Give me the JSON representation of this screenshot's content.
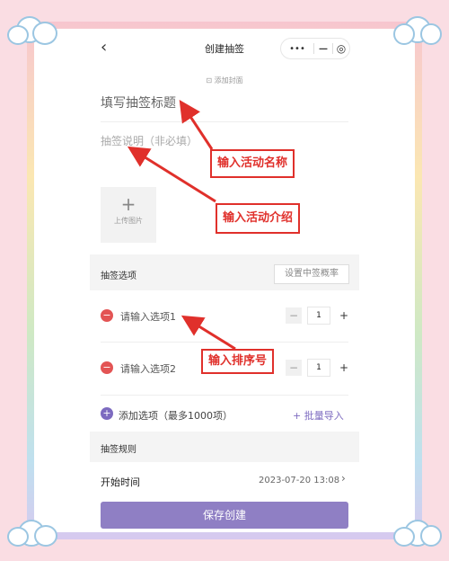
{
  "nav": {
    "back_icon": "‹",
    "title": "创建抽签",
    "capsule_more": "•••",
    "capsule_minimize": "—",
    "capsule_close": "◎"
  },
  "cover_link": "⊡ 添加封面",
  "form": {
    "title_placeholder": "填写抽签标题",
    "desc_placeholder": "抽签说明（非必填）",
    "upload_plus": "+",
    "upload_label": "上传图片"
  },
  "options_section": {
    "heading": "抽签选项",
    "probability_button": "设置中签概率",
    "options": [
      {
        "placeholder": "请输入选项1",
        "count": "1"
      },
      {
        "placeholder": "请输入选项2",
        "count": "1"
      }
    ],
    "stepper_minus": "−",
    "stepper_plus": "+",
    "add_option": "添加选项（最多1000项）",
    "batch_import": "+ 批量导入"
  },
  "rules_section": {
    "heading": "抽签规则",
    "start_time_label": "开始时间",
    "start_time_value": "2023-07-20 13:08",
    "chevron": "›"
  },
  "save_button": "保存创建",
  "annotations": {
    "activity_name": "输入活动名称",
    "activity_intro": "输入活动介绍",
    "sort_number": "输入排序号"
  },
  "colors": {
    "accent_purple": "#8f7fc4",
    "remove_red": "#e35454",
    "annotation_red": "#e0302b",
    "page_pink": "#fadde3"
  }
}
